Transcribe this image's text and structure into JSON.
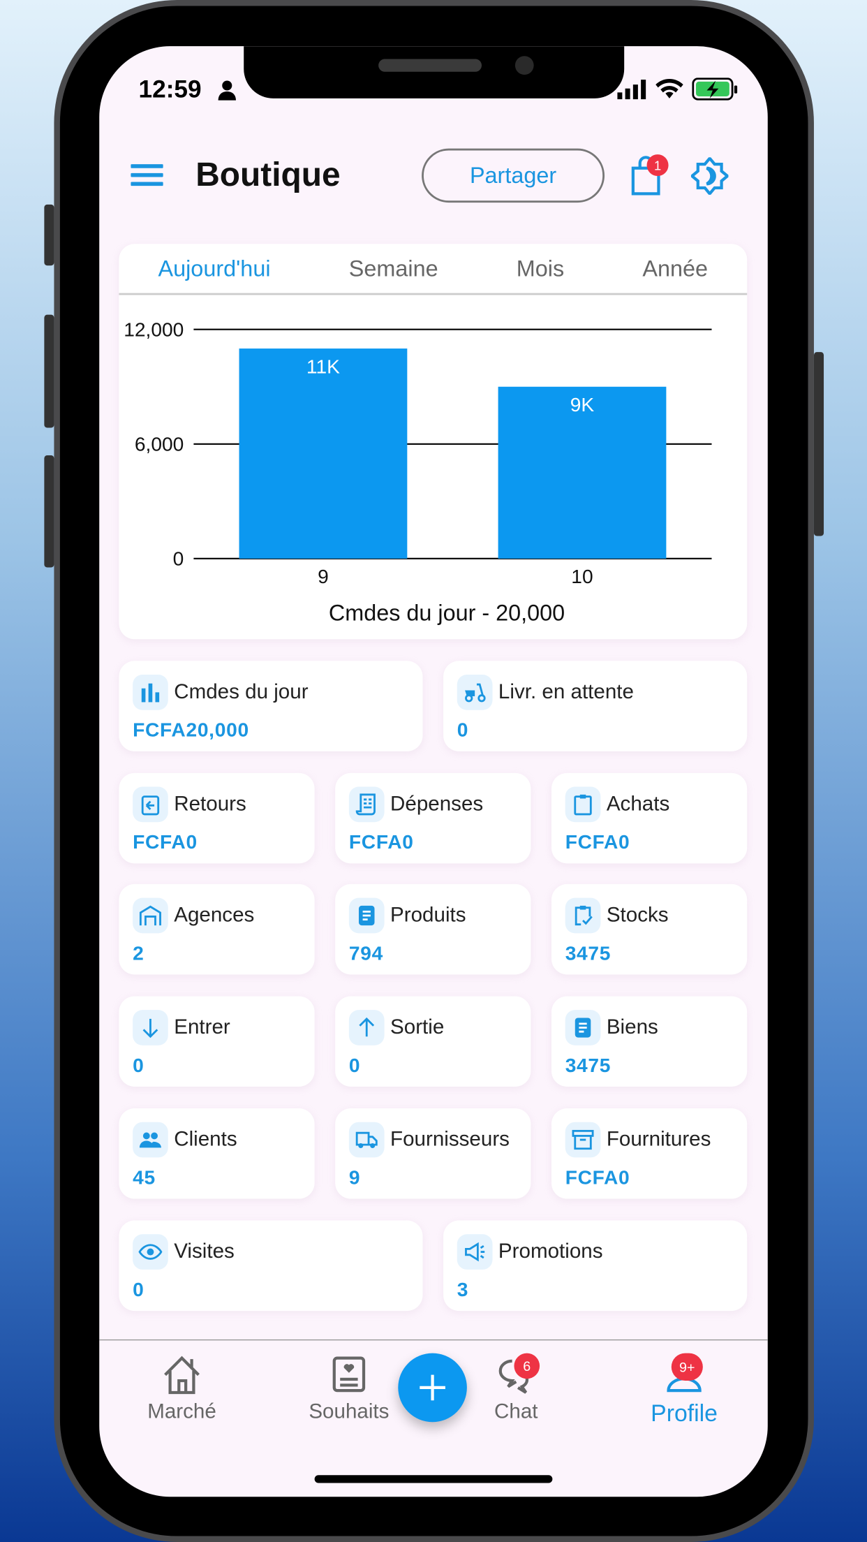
{
  "status_bar": {
    "time": "12:59"
  },
  "header": {
    "title": "Boutique",
    "share_label": "Partager",
    "cart_badge": "1"
  },
  "colors": {
    "accent": "#1a95e0",
    "bar": "#0c98f0",
    "badge": "#ee3344",
    "background": "#fcf4fc"
  },
  "chart_tabs": [
    {
      "label": "Aujourd'hui",
      "active": true
    },
    {
      "label": "Semaine",
      "active": false
    },
    {
      "label": "Mois",
      "active": false
    },
    {
      "label": "Année",
      "active": false
    }
  ],
  "chart_data": {
    "type": "bar",
    "categories": [
      "9",
      "10"
    ],
    "values": [
      11000,
      9000
    ],
    "data_labels": [
      "11K",
      "9K"
    ],
    "yticks": [
      "0",
      "6,000",
      "12,000"
    ],
    "ylim": [
      0,
      12000
    ],
    "xlabel": "Cmdes du jour - 20,000",
    "grid": true
  },
  "stats": [
    {
      "icon": "bar-chart-icon",
      "label": "Cmdes du jour",
      "value": "FCFA20,000"
    },
    {
      "icon": "scooter-icon",
      "label": "Livr. en attente",
      "value": "0"
    },
    {
      "icon": "clipboard-return-icon",
      "label": "Retours",
      "value": "FCFA0"
    },
    {
      "icon": "receipt-icon",
      "label": "Dépenses",
      "value": "FCFA0"
    },
    {
      "icon": "clipboard-icon",
      "label": "Achats",
      "value": "FCFA0"
    },
    {
      "icon": "warehouse-icon",
      "label": "Agences",
      "value": "2"
    },
    {
      "icon": "document-icon",
      "label": "Produits",
      "value": "794"
    },
    {
      "icon": "clipboard-check-icon",
      "label": "Stocks",
      "value": "3475"
    },
    {
      "icon": "arrow-down-icon",
      "label": "Entrer",
      "value": "0"
    },
    {
      "icon": "arrow-up-icon",
      "label": "Sortie",
      "value": "0"
    },
    {
      "icon": "document-icon",
      "label": "Biens",
      "value": "3475"
    },
    {
      "icon": "people-icon",
      "label": "Clients",
      "value": "45"
    },
    {
      "icon": "truck-icon",
      "label": "Fournisseurs",
      "value": "9"
    },
    {
      "icon": "archive-icon",
      "label": "Fournitures",
      "value": "FCFA0"
    },
    {
      "icon": "eye-icon",
      "label": "Visites",
      "value": "0"
    },
    {
      "icon": "megaphone-icon",
      "label": "Promotions",
      "value": "3"
    }
  ],
  "bottom_nav": [
    {
      "label": "Marché",
      "icon": "home-icon"
    },
    {
      "label": "Souhaits",
      "icon": "wishlist-icon"
    },
    {
      "label": "Chat",
      "icon": "chat-icon",
      "badge": "6"
    },
    {
      "label": "Profile",
      "icon": "profile-icon",
      "badge": "9+",
      "active": true
    }
  ]
}
